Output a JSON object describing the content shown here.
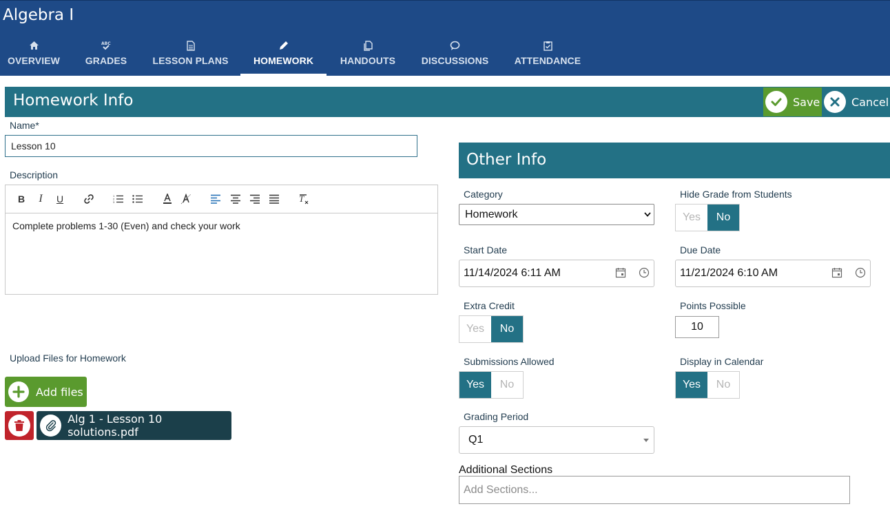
{
  "app": {
    "title": "Algebra I"
  },
  "tabs": [
    {
      "label": "OVERVIEW",
      "icon": "home-icon",
      "active": false
    },
    {
      "label": "GRADES",
      "icon": "grades-check-icon",
      "active": false
    },
    {
      "label": "LESSON PLANS",
      "icon": "document-icon",
      "active": false
    },
    {
      "label": "HOMEWORK",
      "icon": "pencil-icon",
      "active": true
    },
    {
      "label": "HANDOUTS",
      "icon": "copy-icon",
      "active": false
    },
    {
      "label": "DISCUSSIONS",
      "icon": "speech-bubble-icon",
      "active": false
    },
    {
      "label": "ATTENDANCE",
      "icon": "clipboard-check-icon",
      "active": false
    }
  ],
  "header": {
    "title": "Homework Info",
    "save_label": "Save",
    "cancel_label": "Cancel"
  },
  "form": {
    "name_label": "Name*",
    "name_value": "Lesson 10",
    "description_label": "Description",
    "description_value": "Complete problems 1-30 (Even) and check your work",
    "upload_label": "Upload Files for Homework",
    "add_files_label": "Add files",
    "attached_file": "Alg 1 - Lesson 10 solutions.pdf"
  },
  "other_info": {
    "title": "Other Info",
    "category_label": "Category",
    "category_value": "Homework",
    "hide_grade_label": "Hide Grade from Students",
    "hide_grade_value": "No",
    "start_date_label": "Start Date",
    "start_date_value": "11/14/2024 6:11 AM",
    "due_date_label": "Due Date",
    "due_date_value": "11/21/2024 6:10 AM",
    "extra_credit_label": "Extra Credit",
    "extra_credit_value": "No",
    "points_label": "Points Possible",
    "points_value": "10",
    "submissions_label": "Submissions Allowed",
    "submissions_value": "Yes",
    "calendar_label": "Display in Calendar",
    "calendar_value": "Yes",
    "grading_period_label": "Grading Period",
    "grading_period_value": "Q1",
    "additional_sections_label": "Additional Sections",
    "additional_sections_placeholder": "Add Sections..."
  },
  "toggle_labels": {
    "yes": "Yes",
    "no": "No"
  },
  "colors": {
    "nav": "#1e4a87",
    "teal": "#237185",
    "green": "#5a9a2e",
    "red": "#c0232b",
    "chip": "#1b3f4a"
  }
}
